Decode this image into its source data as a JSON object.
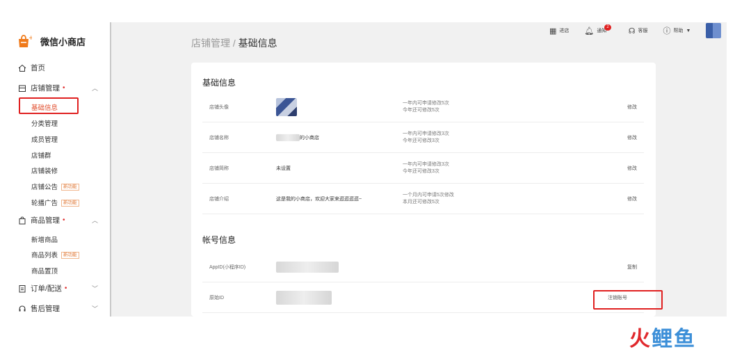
{
  "sidebar": {
    "app_name": "微信小商店",
    "items": [
      {
        "label": "首页",
        "icon": "home-icon"
      },
      {
        "label": "店铺管理",
        "icon": "store-icon",
        "dot": "•",
        "children": [
          {
            "label": "基础信息",
            "active": true
          },
          {
            "label": "分类管理"
          },
          {
            "label": "成员管理"
          },
          {
            "label": "店铺群"
          },
          {
            "label": "店铺装修"
          },
          {
            "label": "店铺公告",
            "tag": "新功能"
          },
          {
            "label": "轮播广告",
            "tag": "新功能"
          }
        ]
      },
      {
        "label": "商品管理",
        "icon": "bag-icon",
        "dot": "•",
        "children": [
          {
            "label": "新增商品"
          },
          {
            "label": "商品列表",
            "tag": "新功能"
          },
          {
            "label": "商品置顶"
          }
        ]
      },
      {
        "label": "订单/配送",
        "icon": "order-icon",
        "dot": "•"
      },
      {
        "label": "售后管理",
        "icon": "headset-icon"
      }
    ]
  },
  "topbar": {
    "store": "进店",
    "notice": "通知",
    "notice_count": "2",
    "service": "客服",
    "help": "帮助"
  },
  "breadcrumb": {
    "parent": "店铺管理",
    "sep": " / ",
    "current": "基础信息"
  },
  "basic": {
    "title": "基础信息",
    "rows": [
      {
        "label": "店铺头像",
        "value": "",
        "note1": "一年内可申请修改5次",
        "note2": "今年还可修改5次",
        "action": "修改"
      },
      {
        "label": "店铺名称",
        "value": "的小商店",
        "note1": "一年内可申请修改3次",
        "note2": "今年还可修改3次",
        "action": "修改"
      },
      {
        "label": "店铺简称",
        "value": "未设置",
        "note1": "一年内可申请修改3次",
        "note2": "今年还可修改3次",
        "action": "修改"
      },
      {
        "label": "店铺介绍",
        "value": "这是我的小商店，欢迎大家来逛逛逛逛~",
        "note1": "一个月内可申请5次修改",
        "note2": "本月还可修改5次",
        "action": "修改"
      }
    ]
  },
  "account": {
    "title": "帐号信息",
    "rows": [
      {
        "label": "AppID(小程序ID)",
        "action": "复制"
      },
      {
        "label": "原始ID",
        "action": "注销账号"
      }
    ]
  },
  "watermark": {
    "part1": "火",
    "part2": "鲤鱼"
  },
  "colors": {
    "accent": "#e04a28",
    "highlight": "#e02020",
    "bg": "#f1f1f1"
  }
}
